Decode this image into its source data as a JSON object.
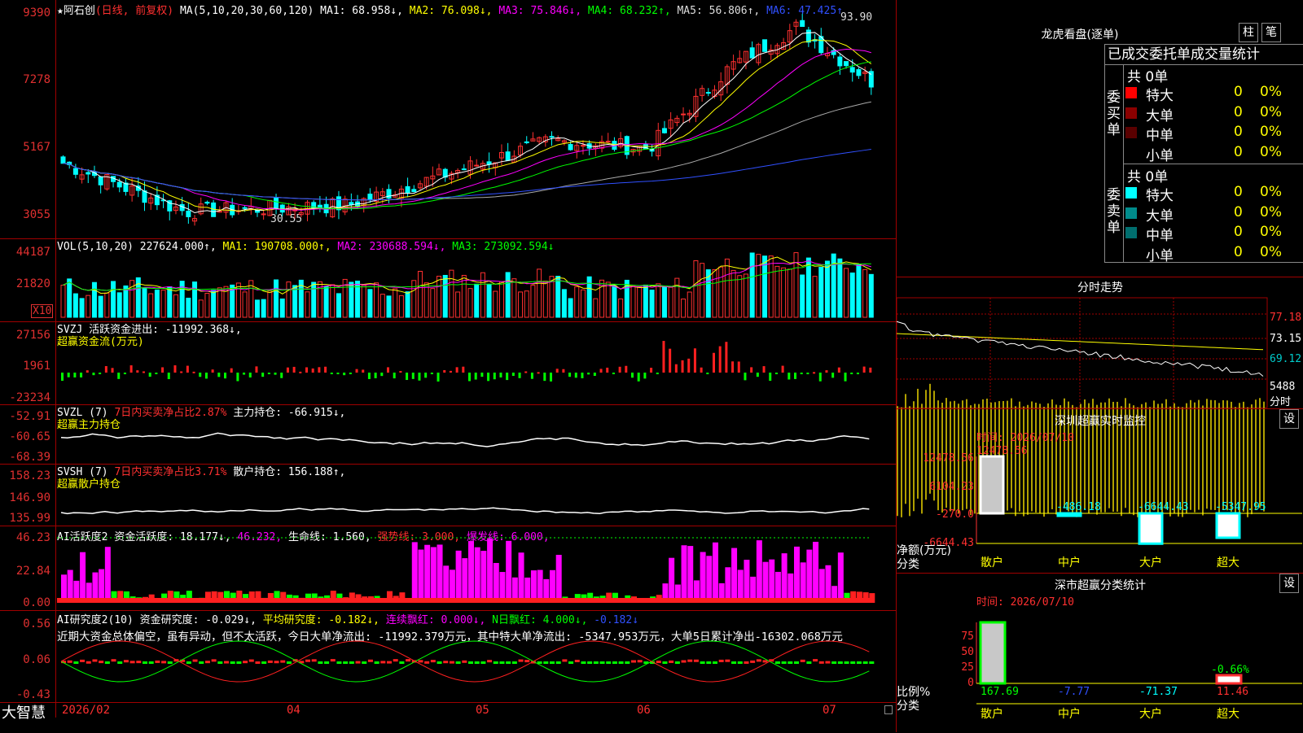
{
  "stock": {
    "title": "★阿石创",
    "period": "(日线, 前复权)"
  },
  "ma_line": {
    "prefix": "MA(5,10,20,30,60,120)",
    "ma1": "MA1: 68.958↓,",
    "ma2": "MA2: 76.098↓,",
    "ma3": "MA3: 75.846↓,",
    "ma4": "MA4: 68.232↑,",
    "ma5": "MA5: 56.806↑,",
    "ma6": "MA6: 47.425↑"
  },
  "price_axis": [
    "9390",
    "7278",
    "5167",
    "3055"
  ],
  "price_marks": {
    "high": "93.90",
    "low": "30.55"
  },
  "vol": {
    "prefix": "VOL(5,10,20)",
    "v": "227624.000↑,",
    "ma1": "MA1: 190708.000↑,",
    "ma2": "MA2: 230688.594↓,",
    "ma3": "MA3: 273092.594↓",
    "axis": [
      "44187",
      "21820"
    ],
    "unit": "X10"
  },
  "svzj": {
    "line1": "SVZJ  活跃资金进出: -11992.368↓,",
    "line2": "超赢资金流(万元)",
    "axis": [
      "27156",
      "1961",
      "-23234"
    ]
  },
  "svzl": {
    "name": "SVZL (7)",
    "pct": "7日内买卖净占比2.87%",
    "val": "主力持仓: -66.915↓,",
    "line2": "超赢主力持仓",
    "axis": [
      "-52.91",
      "-60.65",
      "-68.39"
    ]
  },
  "svsh": {
    "name": "SVSH (7)",
    "pct": "7日内买卖净占比3.71%",
    "val": "散户持仓: 156.188↑,",
    "line2": "超赢散户持仓",
    "axis": [
      "158.23",
      "146.90",
      "135.99"
    ]
  },
  "ai1": {
    "name": "AI活跃度2",
    "a": "资金活跃度: 18.177↓,",
    "b": "46.232,",
    "c": "生命线: 1.560,",
    "d": "强势线: 3.000,",
    "e": "爆发线: 6.000,",
    "axis": [
      "46.23",
      "22.84",
      "0.00"
    ]
  },
  "ai2": {
    "name": "AI研究度2(10)",
    "a": "资金研究度: -0.029↓,",
    "b": "平均研究度: -0.182↓,",
    "c": "连续飘红: 0.000↓,",
    "d": "N日飘红: 4.000↓,",
    "e": "-0.182↓",
    "text": "近期大资金总体偏空，虽有异动，但不太活跃，今日大单净流出: -11992.379万元，其中特大单净流出: -5347.953万元，大单5日累计净出-16302.068万元",
    "axis": [
      "0.56",
      "0.06",
      "-0.43"
    ]
  },
  "dates": [
    "2026/02",
    "04",
    "05",
    "06",
    "07"
  ],
  "brand": "大智慧",
  "right": {
    "lhb_title": "龙虎看盘(逐单)",
    "btn_zhu": "柱",
    "btn_bi": "笔",
    "tabs": "已成交委托单成交量统计",
    "buy_label": "委买单",
    "sell_label": "委卖单",
    "buy_total": "共 0单",
    "sell_total": "共 0单",
    "buy_rows": [
      {
        "name": "特大",
        "n": "0",
        "p": "0%",
        "color": "#ff0000"
      },
      {
        "name": "大单",
        "n": "0",
        "p": "0%",
        "color": "#8b0000"
      },
      {
        "name": "中单",
        "n": "0",
        "p": "0%",
        "color": "#5a0000"
      },
      {
        "name": "小单",
        "n": "0",
        "p": "0%",
        "color": "#000000"
      }
    ],
    "sell_rows": [
      {
        "name": "特大",
        "n": "0",
        "p": "0%",
        "color": "#00ffff"
      },
      {
        "name": "大单",
        "n": "0",
        "p": "0%",
        "color": "#008b8b"
      },
      {
        "name": "中单",
        "n": "0",
        "p": "0%",
        "color": "#006e6e"
      },
      {
        "name": "小单",
        "n": "0",
        "p": "0%",
        "color": "#000000"
      }
    ],
    "fs_title": "分时走势",
    "fs_axis": [
      "77.18",
      "73.15",
      "69.12",
      "5488"
    ],
    "fs_foot": "分时",
    "sz_title": "深圳超赢实时监控",
    "sz_btn": "设",
    "sz_time": "时间: 2026/07/10",
    "sz_top": "12478.56",
    "sz_axis": [
      "12478.56",
      "6104.23",
      "-270.0",
      "-6644.43"
    ],
    "sz_vals": [
      "-486.18",
      "-6644.43",
      "-5347.95"
    ],
    "sz_ylab": "净额(万元)",
    "sz_cat": "分类",
    "cats": [
      "散户",
      "中户",
      "大户",
      "超大"
    ],
    "fl_title": "深市超赢分类统计",
    "fl_btn": "设",
    "fl_time": "时间: 2026/07/10",
    "fl_axis": [
      "75",
      "50",
      "25",
      "0"
    ],
    "fl_top": "-0.66%",
    "fl_vals": [
      "167.69",
      "-7.77",
      "-71.37",
      "11.46"
    ],
    "fl_ylab": "比例%",
    "fl_cat": "分类"
  }
}
